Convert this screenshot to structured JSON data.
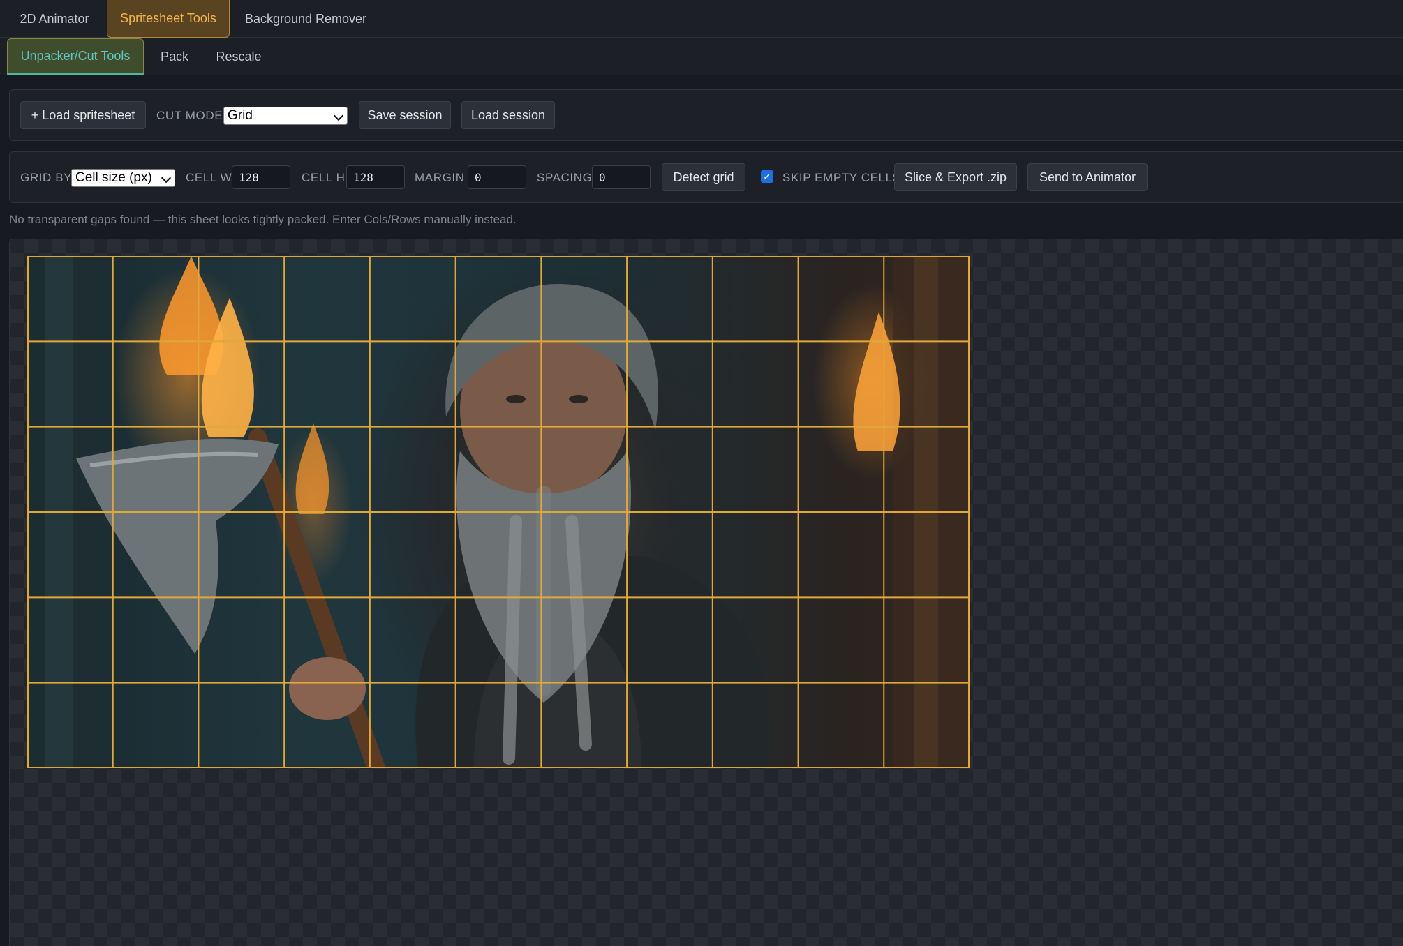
{
  "top_tabs": [
    "2D Animator",
    "Spritesheet Tools",
    "Background Remover"
  ],
  "active_top_tab": "Spritesheet Tools",
  "sub_tabs": [
    "Unpacker/Cut Tools",
    "Pack",
    "Rescale"
  ],
  "active_sub_tab": "Unpacker/Cut Tools",
  "toolbar1": {
    "load_spritesheet": "+ Load spritesheet",
    "cut_mode_label": "CUT MODE",
    "cut_mode_value": "Grid",
    "save_session": "Save session",
    "load_session": "Load session"
  },
  "toolbar2": {
    "grid_by_label": "GRID BY",
    "grid_by_value": "Cell size (px)",
    "cell_w_label": "CELL W",
    "cell_w_value": "128",
    "cell_h_label": "CELL H",
    "cell_h_value": "128",
    "margin_label": "MARGIN",
    "margin_value": "0",
    "spacing_label": "SPACING",
    "spacing_value": "0",
    "detect_grid": "Detect grid",
    "skip_empty_checked": true,
    "skip_empty_label": "SKIP EMPTY CELLS",
    "slice_export": "Slice & Export .zip",
    "send_animator": "Send to Animator"
  },
  "hint": "No transparent gaps found — this sheet looks tightly packed. Enter Cols/Rows manually instead.",
  "grid": {
    "cols": 11,
    "rows": 6,
    "line_color": "#e0a83a"
  },
  "colors": {
    "accent_orange": "#f3b552",
    "accent_teal": "#5fc7c3",
    "checkbox_blue": "#1f6fe0"
  }
}
